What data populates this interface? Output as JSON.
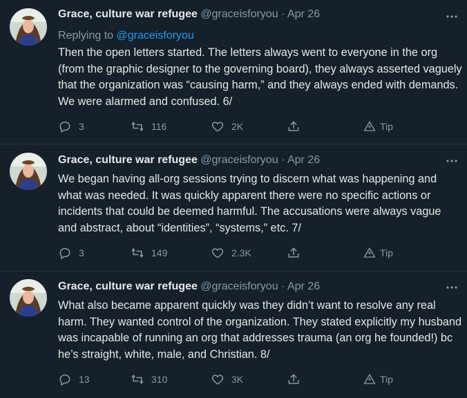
{
  "tweets": [
    {
      "author_name": "Grace, culture war refugee",
      "handle": "@graceisforyou",
      "sep": "·",
      "date": "Apr 26",
      "replying_to_prefix": "Replying to",
      "replying_to_handle": "@graceisforyou",
      "text": "Then the open letters started. The letters always went to everyone in the org (from the graphic designer to the governing board), they always asserted vaguely that the organization was “causing harm,” and they always ended with demands. We were alarmed and confused. 6/",
      "replies": "3",
      "retweets": "116",
      "likes": "2K",
      "tip_label": "Tip"
    },
    {
      "author_name": "Grace, culture war refugee",
      "handle": "@graceisforyou",
      "sep": "·",
      "date": "Apr 26",
      "text": "We began having all-org sessions trying to discern what was happening and what was needed. It was quickly apparent there were no specific actions or incidents that could be deemed harmful. The accusations were always vague and abstract, about “identities”, “systems,” etc. 7/",
      "replies": "3",
      "retweets": "149",
      "likes": "2.3K",
      "tip_label": "Tip"
    },
    {
      "author_name": "Grace, culture war refugee",
      "handle": "@graceisforyou",
      "sep": "·",
      "date": "Apr 26",
      "text": "What also became apparent quickly was they didn’t want to resolve any real harm. They wanted control of the organization. They stated explicitly my husband was incapable of running an org that addresses trauma (an org he founded!) bc he’s straight, white, male, and Christian. 8/",
      "replies": "13",
      "retweets": "310",
      "likes": "3K",
      "tip_label": "Tip"
    }
  ],
  "colors": {
    "background": "#15202b",
    "muted": "#8899a6",
    "link": "#1d9bf0",
    "text": "#e6e6e6"
  },
  "icons": [
    "avatar",
    "more-icon",
    "reply-icon",
    "retweet-icon",
    "like-icon",
    "share-icon",
    "tip-icon"
  ]
}
